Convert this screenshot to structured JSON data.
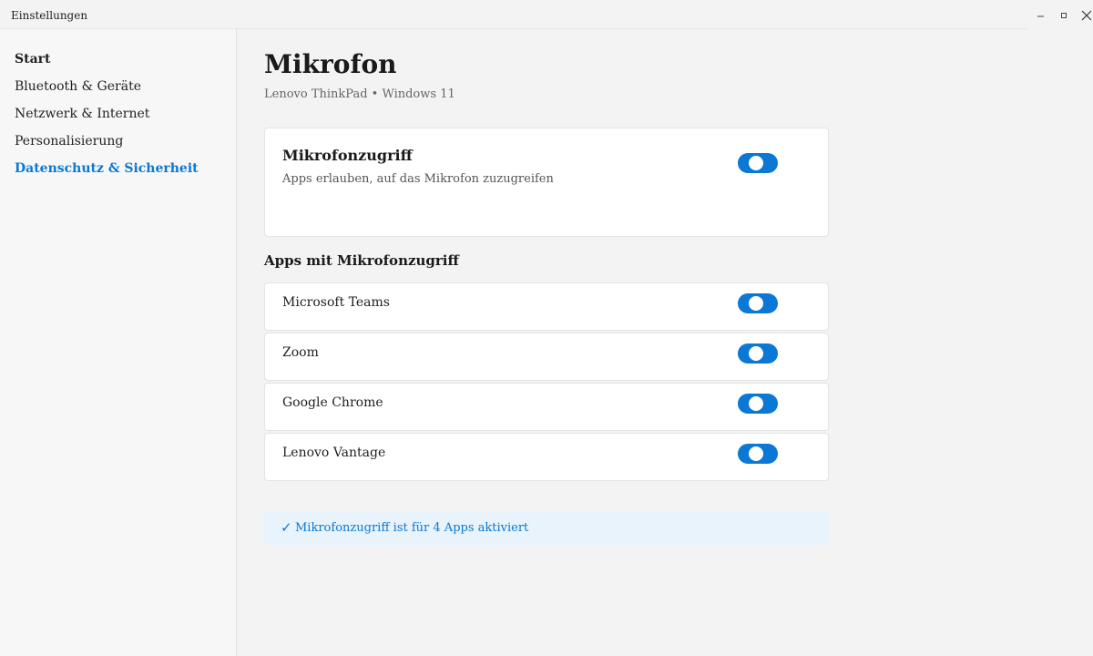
{
  "window": {
    "title": "Einstellungen",
    "minimize_icon": "minimize-icon",
    "maximize_icon": "maximize-icon",
    "close_icon": "close-icon"
  },
  "sidebar": {
    "items": [
      {
        "label": "Start",
        "active": false
      },
      {
        "label": "Bluetooth & Geräte",
        "active": false
      },
      {
        "label": "Netzwerk & Internet",
        "active": false
      },
      {
        "label": "Personalisierung",
        "active": false
      },
      {
        "label": "Datenschutz & Sicherheit",
        "active": true
      }
    ]
  },
  "main": {
    "title": "Mikrofon",
    "subtitle": "Lenovo ThinkPad • Windows 11",
    "master": {
      "title": "Mikrofonzugriff",
      "description": "Apps erlauben, auf das Mikrofon zuzugreifen",
      "enabled": true
    },
    "apps_heading": "Apps mit Mikrofonzugriff",
    "apps": [
      {
        "name": "Microsoft Teams",
        "enabled": true
      },
      {
        "name": "Zoom",
        "enabled": true
      },
      {
        "name": "Google Chrome",
        "enabled": true
      },
      {
        "name": "Lenovo Vantage",
        "enabled": true
      }
    ],
    "status": {
      "icon": "checkmark-icon",
      "check_glyph": "✓",
      "text": "Mikrofonzugriff ist für 4 Apps aktiviert"
    }
  },
  "colors": {
    "accent": "#0a78d4",
    "status_background": "#e8f3fc"
  }
}
